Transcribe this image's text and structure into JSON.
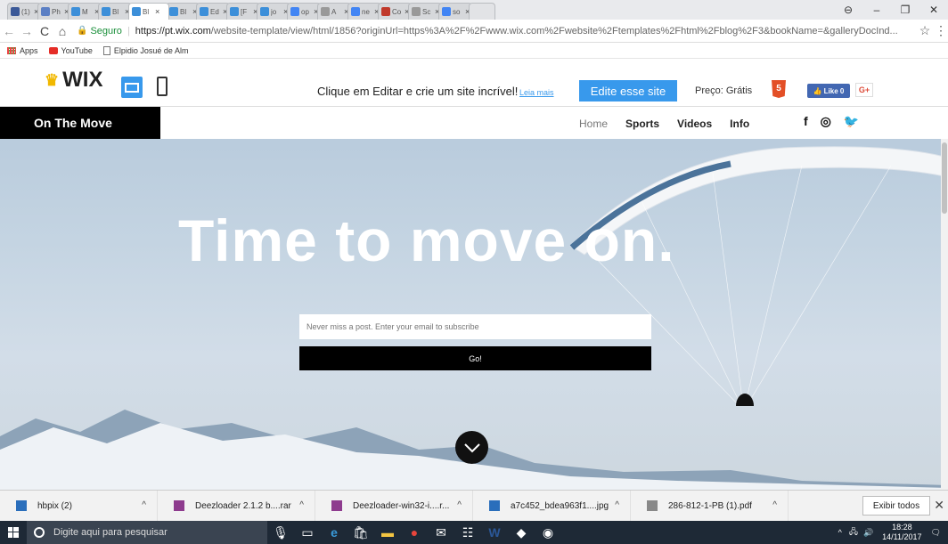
{
  "browser": {
    "tabs": [
      {
        "label": "(1)",
        "color": "#3b5998"
      },
      {
        "label": "Ph",
        "color": "#5b7fc4"
      },
      {
        "label": "M",
        "color": "#3c8fd9"
      },
      {
        "label": "Bl",
        "color": "#3c8fd9"
      },
      {
        "label": "Bl",
        "color": "#3c8fd9",
        "active": true
      },
      {
        "label": "Bl",
        "color": "#3c8fd9"
      },
      {
        "label": "Ed",
        "color": "#3c8fd9"
      },
      {
        "label": "[F",
        "color": "#3c8fd9"
      },
      {
        "label": "jo",
        "color": "#3c8fd9"
      },
      {
        "label": "op",
        "color": "#4285f4"
      },
      {
        "label": "A",
        "color": "#999999"
      },
      {
        "label": "ne",
        "color": "#4285f4"
      },
      {
        "label": "Co",
        "color": "#c0392b"
      },
      {
        "label": "Sc",
        "color": "#999999"
      },
      {
        "label": "so",
        "color": "#4285f4"
      }
    ],
    "url_secure_label": "Seguro",
    "url_host": "https://pt.wix.com",
    "url_path": "/website-template/view/html/1856?originUrl=https%3A%2F%2Fwww.wix.com%2Fwebsite%2Ftemplates%2Fhtml%2Fblog%2F3&bookName=&galleryDocInd...",
    "bookmarks": [
      "Apps",
      "YouTube",
      "Elpidio Josué de Alm"
    ]
  },
  "wixbar": {
    "logo": "WIX",
    "message": "Clique em Editar e crie um site incrível!",
    "more_link": "Leia mais",
    "edit_button": "Edite esse site",
    "price": "Preço: Grátis",
    "html5": "5",
    "fb_like": "Like 0",
    "gplus": "G+"
  },
  "site": {
    "logo": "On The Move",
    "nav": [
      "Home",
      "Sports",
      "Videos",
      "Info"
    ],
    "social": [
      "f",
      "◎",
      "🐦"
    ],
    "hero_title": "Time to move on.",
    "email_placeholder": "Never miss a post. Enter your email to subscribe",
    "go_button": "Go!"
  },
  "downloads": {
    "items": [
      {
        "name": "hbpix (2)",
        "color": "#2a6ebb"
      },
      {
        "name": "Deezloader 2.1.2 b....rar",
        "color": "#8e3b8e"
      },
      {
        "name": "Deezloader-win32-i....r...",
        "color": "#8e3b8e"
      },
      {
        "name": "a7c452_bdea963f1....jpg",
        "color": "#2a6ebb"
      },
      {
        "name": "286-812-1-PB (1).pdf",
        "color": "#888888"
      }
    ],
    "show_all": "Exibir todos"
  },
  "taskbar": {
    "search_placeholder": "Digite aqui para pesquisar",
    "time": "18:28",
    "date": "14/11/2017"
  }
}
